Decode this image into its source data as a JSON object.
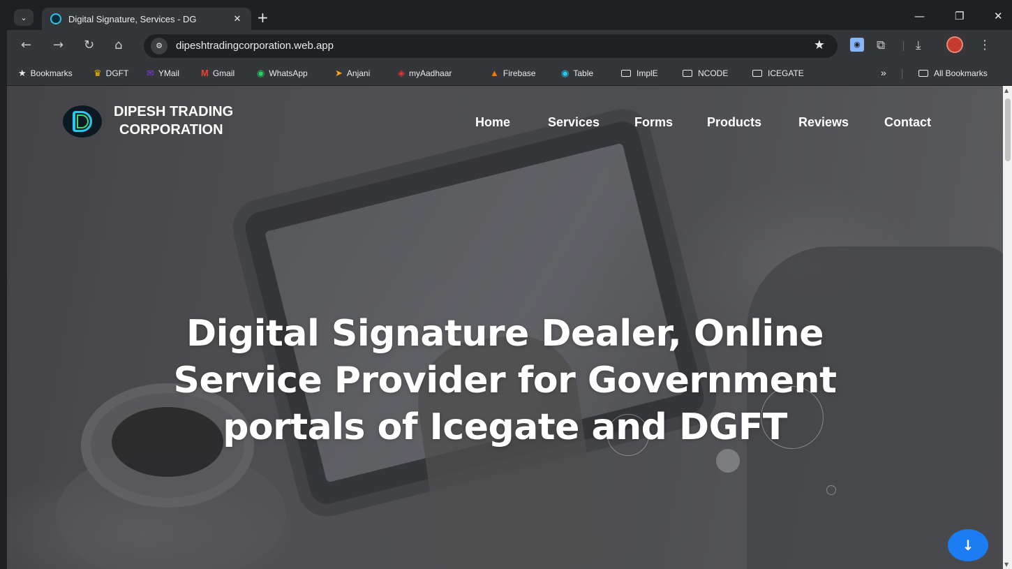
{
  "browser": {
    "tab": {
      "title": "Digital Signature, Services - DG",
      "close": "✕"
    },
    "new_tab": "+",
    "window_controls": {
      "minimize": "—",
      "restore": "❐",
      "close": "✕"
    },
    "url": "dipeshtradingcorporation.web.app",
    "bookmarks": [
      {
        "label": "Bookmarks",
        "icon": "★",
        "color": "#e8eaed"
      },
      {
        "label": "DGFT",
        "icon": "♛",
        "color": "#f5b800"
      },
      {
        "label": "YMail",
        "icon": "✉",
        "color": "#7b39e6"
      },
      {
        "label": "Gmail",
        "icon": "M",
        "color": "#ea4335"
      },
      {
        "label": "WhatsApp",
        "icon": "◉",
        "color": "#25d366"
      },
      {
        "label": "Anjani",
        "icon": "➤",
        "color": "#f5a623"
      },
      {
        "label": "myAadhaar",
        "icon": "◈",
        "color": "#e53935"
      },
      {
        "label": "Firebase",
        "icon": "▲",
        "color": "#f57c00"
      },
      {
        "label": "Table",
        "icon": "◉",
        "color": "#28c7ef"
      },
      {
        "label": "ImplE",
        "icon": "folder",
        "color": "#e8eaed"
      },
      {
        "label": "NCODE",
        "icon": "folder",
        "color": "#e8eaed"
      },
      {
        "label": "ICEGATE",
        "icon": "folder",
        "color": "#e8eaed"
      }
    ],
    "more_bookmarks": "»",
    "all_bookmarks": "All Bookmarks"
  },
  "site": {
    "brand_line1": "DIPESH TRADING",
    "brand_line2": "CORPORATION",
    "nav": [
      "Home",
      "Services",
      "Forms",
      "Products",
      "Reviews",
      "Contact"
    ],
    "headline_line1": "Digital Signature Dealer, Online",
    "headline_line2": "Service Provider for Government",
    "headline_line3": "portals of Icegate and DGFT",
    "scroll_button_icon": "arrow-down-icon",
    "accent_color": "#1b7cf3"
  }
}
